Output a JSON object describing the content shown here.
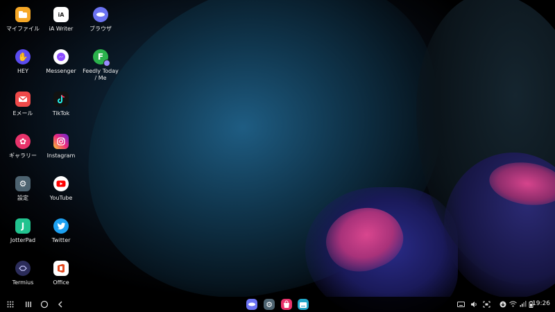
{
  "desktop": {
    "icons": [
      {
        "label": "マイファイル",
        "icon": "folder-icon",
        "color": "#f6a827"
      },
      {
        "label": "iA Writer",
        "icon": "ia-writer-icon",
        "color": "#ffffff"
      },
      {
        "label": "ブラウザ",
        "icon": "browser-icon",
        "color": "#6c73f2"
      },
      {
        "label": "HEY",
        "icon": "hey-hand-icon",
        "color": "#5b4cf0"
      },
      {
        "label": "Messenger",
        "icon": "messenger-icon",
        "color": "#ffffff"
      },
      {
        "label": "Feedly Today\n/ Me",
        "icon": "feedly-icon",
        "color": "#2bb24c",
        "letter": "F"
      },
      {
        "label": "Eメール",
        "icon": "email-icon",
        "color": "#f04a4a"
      },
      {
        "label": "TikTok",
        "icon": "tiktok-icon",
        "color": "#111111"
      },
      {
        "label": "ギャラリー",
        "icon": "gallery-flower-icon",
        "color": "#e8336b"
      },
      {
        "label": "Instagram",
        "icon": "instagram-icon",
        "color": "#d6336c"
      },
      {
        "label": "設定",
        "icon": "settings-gear-icon",
        "color": "#4d6370"
      },
      {
        "label": "YouTube",
        "icon": "youtube-icon",
        "color": "#ffffff"
      },
      {
        "label": "JotterPad",
        "icon": "jotterpad-icon",
        "color": "#22c38f",
        "letter": "J"
      },
      {
        "label": "Twitter",
        "icon": "twitter-bird-icon",
        "color": "#1da1f2"
      },
      {
        "label": "Termius",
        "icon": "termius-icon",
        "color": "#2b2c5a"
      },
      {
        "label": "Office",
        "icon": "office-icon",
        "color": "#ffffff"
      }
    ]
  },
  "taskbar": {
    "nav": [
      {
        "icon": "app-grid-icon"
      },
      {
        "icon": "recents-icon"
      },
      {
        "icon": "home-icon"
      },
      {
        "icon": "back-icon"
      }
    ],
    "pinned": [
      {
        "icon": "browser-icon",
        "color": "#6c73f2"
      },
      {
        "icon": "settings-gear-icon",
        "color": "#4d6370"
      },
      {
        "icon": "galaxy-store-icon",
        "color": "#e8336b"
      },
      {
        "icon": "keyboard-app-icon",
        "color": "#22a6c8"
      }
    ],
    "tray": [
      {
        "icon": "keyboard-icon"
      },
      {
        "icon": "volume-icon"
      },
      {
        "icon": "screenshot-icon"
      },
      {
        "icon": "download-icon"
      },
      {
        "icon": "wifi-icon"
      },
      {
        "icon": "signal-icon"
      },
      {
        "icon": "battery-icon"
      }
    ],
    "time": "19:26"
  }
}
